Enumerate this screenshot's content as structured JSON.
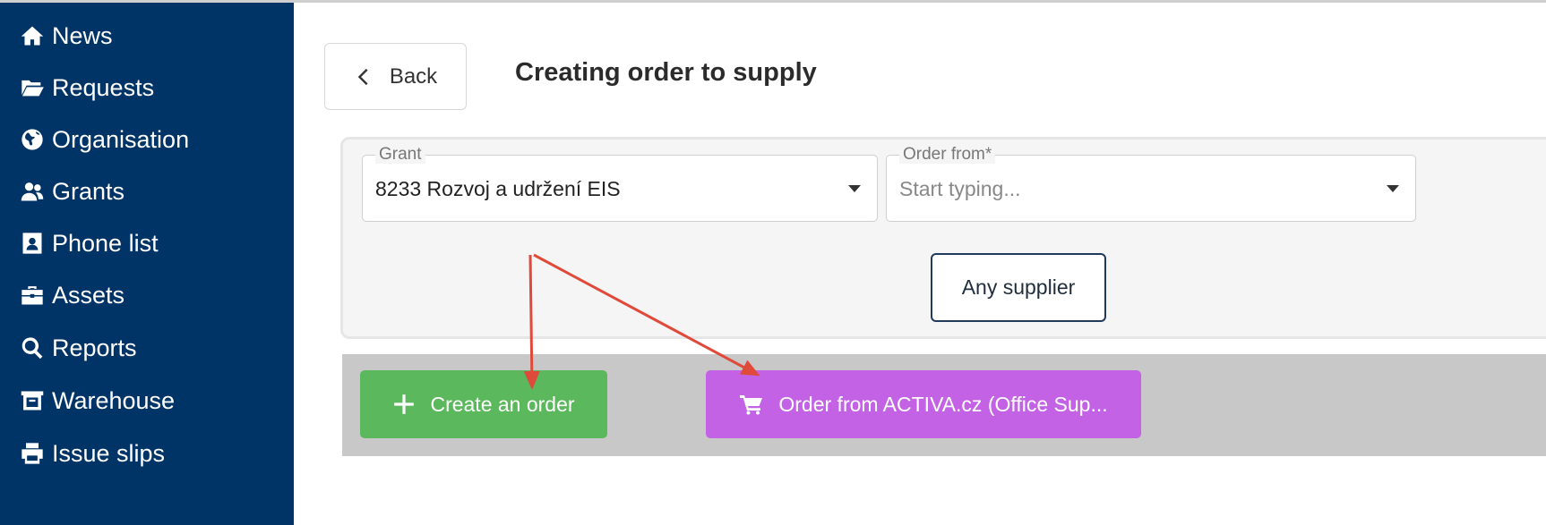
{
  "sidebar": {
    "items": [
      {
        "label": "News",
        "icon": "home-icon"
      },
      {
        "label": "Requests",
        "icon": "folder-open-icon"
      },
      {
        "label": "Organisation",
        "icon": "globe-icon"
      },
      {
        "label": "Grants",
        "icon": "users-icon"
      },
      {
        "label": "Phone list",
        "icon": "contact-card-icon"
      },
      {
        "label": "Assets",
        "icon": "toolbox-icon"
      },
      {
        "label": "Reports",
        "icon": "search-icon"
      },
      {
        "label": "Warehouse",
        "icon": "warehouse-icon"
      },
      {
        "label": "Issue slips",
        "icon": "printer-icon"
      }
    ],
    "bg_color": "#003366"
  },
  "header": {
    "back_label": "Back",
    "title": "Creating order to supply"
  },
  "filters": {
    "grant": {
      "label": "Grant",
      "value": "8233 Rozvoj a udržení EIS"
    },
    "order_from": {
      "label": "Order from*",
      "value": "",
      "placeholder": "Start typing..."
    },
    "any_supplier_label": "Any supplier"
  },
  "actions": {
    "create_label": "Create an order",
    "create_color": "#5cb85c",
    "activa_label": "Order from ACTIVA.cz (Office Sup...",
    "activa_color": "#c462e6"
  },
  "annotation_color": "#e04a3a"
}
